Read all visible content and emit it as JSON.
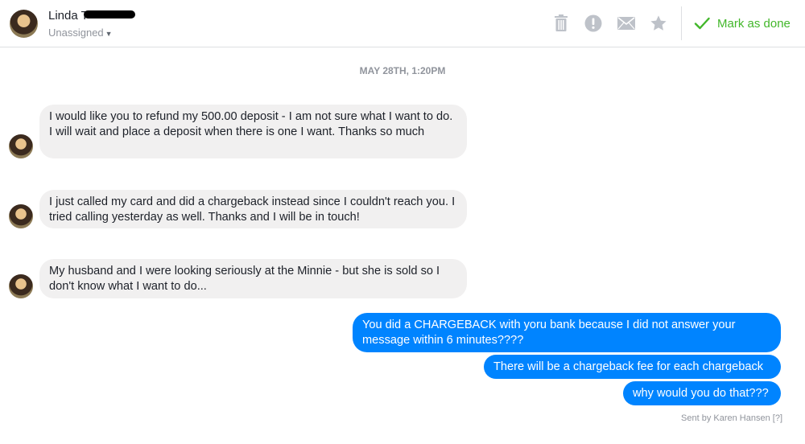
{
  "header": {
    "name": "Linda T",
    "assignment": "Unassigned",
    "mark_done_label": "Mark as done",
    "icons": [
      "trash-icon",
      "alert-icon",
      "envelope-icon",
      "star-icon",
      "checkmark-icon"
    ],
    "accent_color": "#42b72a"
  },
  "timestamp": "MAY 28TH, 1:20PM",
  "messages": [
    {
      "direction": "incoming",
      "text": "I would like you to refund my 500.00 deposit - I am not sure what I want to do.  I will wait and place a deposit when there is one I want.  Thanks so much"
    },
    {
      "direction": "incoming",
      "text": "I just called my card and did a chargeback instead since I couldn't reach you.  I tried calling yesterday as well.  Thanks and I will be in touch!"
    },
    {
      "direction": "incoming",
      "text": "My husband and I were looking seriously at the Minnie - but she is sold so I don't know what I want to do..."
    },
    {
      "direction": "outgoing",
      "text": "You did a CHARGEBACK with yoru bank because I did not answer your message within 6 minutes????"
    },
    {
      "direction": "outgoing",
      "text": "There will be a chargeback fee for each chargeback"
    },
    {
      "direction": "outgoing",
      "text": "why would you do that???"
    }
  ],
  "sent_by": "Sent by Karen Hansen [?]",
  "colors": {
    "outgoing_bubble": "#0084ff",
    "incoming_bubble": "#f1f0f0"
  }
}
